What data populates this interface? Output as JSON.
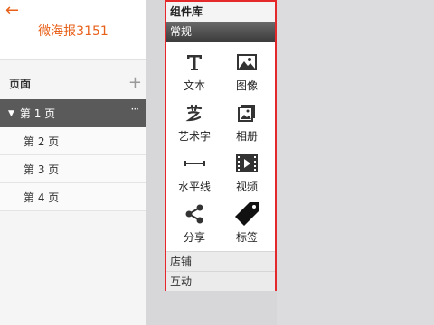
{
  "app": {
    "back_glyph": "←",
    "title": "微海报3151"
  },
  "pages": {
    "section_label": "页面",
    "add_glyph": "+",
    "items": [
      {
        "label": "第 1 页",
        "more": "···"
      },
      {
        "label": "第 2 页"
      },
      {
        "label": "第 3 页"
      },
      {
        "label": "第 4 页"
      }
    ]
  },
  "library": {
    "title": "组件库",
    "categories": [
      "常规",
      "店铺",
      "互动"
    ],
    "components": [
      {
        "label": "文本",
        "icon": "text-icon"
      },
      {
        "label": "图像",
        "icon": "image-icon"
      },
      {
        "label": "艺术字",
        "icon": "art-text-icon"
      },
      {
        "label": "相册",
        "icon": "album-icon"
      },
      {
        "label": "水平线",
        "icon": "horizontal-line-icon"
      },
      {
        "label": "视频",
        "icon": "video-icon"
      },
      {
        "label": "分享",
        "icon": "share-icon"
      },
      {
        "label": "标签",
        "icon": "tag-icon"
      }
    ]
  },
  "colors": {
    "accent": "#e8611a",
    "highlight_border": "#e5292b",
    "active_dark": "#5a5a5a"
  }
}
